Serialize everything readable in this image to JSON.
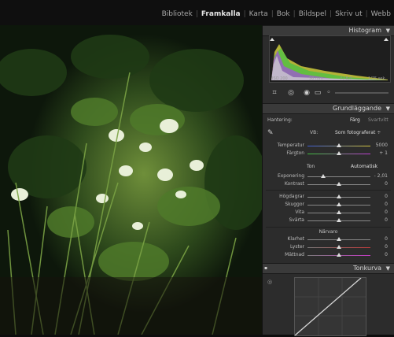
{
  "modules": [
    "Bibliotek",
    "Framkalla",
    "Karta",
    "Bok",
    "Bildspel",
    "Skriv ut",
    "Webb"
  ],
  "active_module": "Framkalla",
  "histogram": {
    "title": "Histogram",
    "iso": "ISO 200",
    "focal": "50 mm",
    "aperture": "f / 8,0",
    "shutter": "1/25 sek."
  },
  "basic": {
    "title": "Grundläggande",
    "treatment_label": "Hantering:",
    "color_option": "Färg",
    "bw_option": "Svartvitt",
    "wb_label": "VB:",
    "wb_value": "Som fotograferat ÷",
    "temp_label": "Temperatur",
    "temp_value": "5000",
    "tint_label": "Färgton",
    "tint_value": "+ 1",
    "tone_label": "Ton",
    "auto_label": "Automatisk",
    "exposure_label": "Exponering",
    "exposure_value": "- 2,01",
    "contrast_label": "Kontrast",
    "contrast_value": "0",
    "highlights_label": "Högdagrar",
    "highlights_value": "0",
    "shadows_label": "Skuggor",
    "shadows_value": "0",
    "whites_label": "Vita",
    "whites_value": "0",
    "blacks_label": "Svärta",
    "blacks_value": "0",
    "presence_label": "Närvaro",
    "clarity_label": "Klarhet",
    "clarity_value": "0",
    "vibrance_label": "Lyster",
    "vibrance_value": "0",
    "saturation_label": "Mättnad",
    "saturation_value": "0"
  },
  "tonecurve": {
    "title": "Tonkurva"
  },
  "colors": {
    "accent": "#e6e6e6",
    "panel": "#2c2c2c",
    "header": "#3a3a3a"
  }
}
